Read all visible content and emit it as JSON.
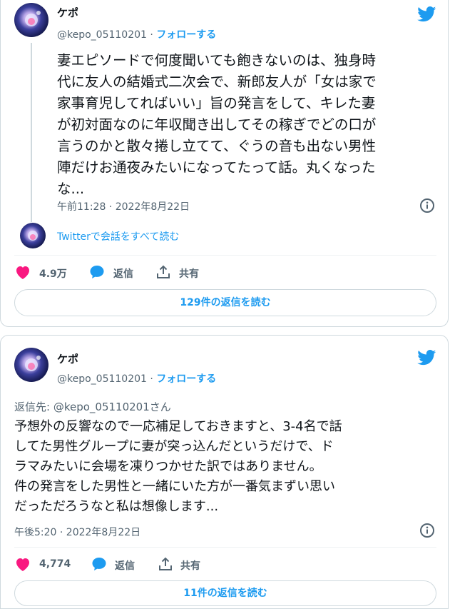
{
  "tweet1": {
    "author_name": "ケポ",
    "handle": "@kepo_05110201",
    "dot": "·",
    "follow_label": "フォローする",
    "lines": [
      "妻エピソードで何度聞いても飽きないのは、独身時",
      "代に友人の結婚式二次会で、新郎友人が「女は家で",
      "家事育児してればいい」旨の発言をして、キレた妻",
      "が初対面なのに年収聞き出してその稼ぎでどの口が",
      "言うのかと散々捲し立てて、ぐうの音も出ない男性",
      "陣だけお通夜みたいになってたって話。丸くなった",
      "な..."
    ],
    "timestamp": "午前11:28 · 2022年8月22日",
    "conversation_link": "Twitterで会話をすべて読む",
    "likes": "4.9万",
    "reply_label": "返信",
    "share_label": "共有",
    "read_replies": "129件の返信を読む"
  },
  "tweet2": {
    "author_name": "ケポ",
    "handle": "@kepo_05110201",
    "dot": "·",
    "follow_label": "フォローする",
    "reply_to": "返信先: @kepo_05110201さん",
    "lines": [
      "予想外の反響なので一応補足しておきますと、3-4名で話",
      "してた男性グループに妻が突っ込んだというだけで、ド",
      "ラマみたいに会場を凍りつかせた訳ではありません。",
      "件の発言をした男性と一緒にいた方が一番気まずい思い",
      "だっただろうなと私は想像します..."
    ],
    "timestamp": "午後5:20 · 2022年8月22日",
    "likes": "4,774",
    "reply_label": "返信",
    "share_label": "共有",
    "read_replies": "11件の返信を読む"
  },
  "colors": {
    "text": "#0f1419",
    "secondary": "#536471",
    "accent": "#1d9bf0",
    "like": "#f91880",
    "border": "#cfd9de"
  },
  "icons": [
    "twitter-bird-icon",
    "info-icon",
    "heart-icon",
    "reply-bubble-icon",
    "share-icon",
    "avatar"
  ]
}
